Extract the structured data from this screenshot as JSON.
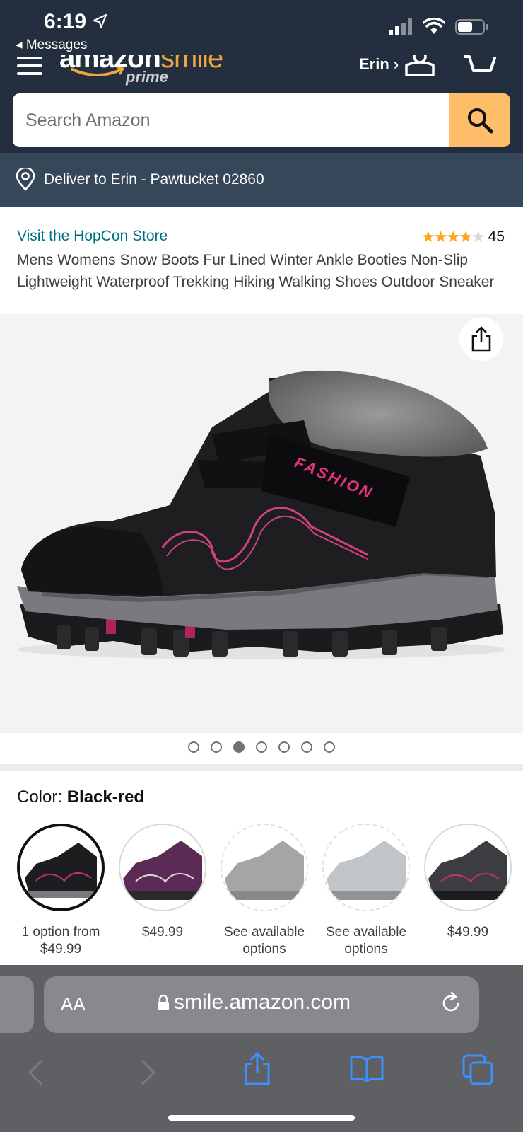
{
  "status_bar": {
    "time": "6:19",
    "back_label": "◂ Messages"
  },
  "header": {
    "logo_text": "amazon",
    "logo_smile": "smile",
    "logo_sub": "prime",
    "account_label": "Erin ›"
  },
  "search": {
    "placeholder": "Search Amazon"
  },
  "delivery": {
    "text": "Deliver to Erin - Pawtucket 02860"
  },
  "product": {
    "store_link": "Visit the HopCon Store",
    "rating_stars": 4,
    "rating_count": "45",
    "title": "Mens Womens Snow Boots Fur Lined Winter Ankle Booties Non-Slip Lightweight Waterproof Trekking Hiking Walking Shoes Outdoor Sneaker",
    "image_dots": 7,
    "active_dot": 2,
    "image_text": "FASHION"
  },
  "color": {
    "label": "Color:",
    "selected_value": "Black-red",
    "swatches": [
      {
        "name": "black-red",
        "caption": "1 option from $49.99",
        "selected": true
      },
      {
        "name": "purple",
        "caption": "$49.99",
        "selected": false
      },
      {
        "name": "grey",
        "caption": "See available options",
        "selected": false
      },
      {
        "name": "light-grey",
        "caption": "See available options",
        "selected": false
      },
      {
        "name": "dark-grey-red",
        "caption": "$49.99",
        "selected": false
      }
    ]
  },
  "browser": {
    "aa_label": "AA",
    "url": "smile.amazon.com"
  },
  "colors": {
    "header_bg": "#232f3e",
    "deliver_bg": "#37475a",
    "search_button": "#febd69",
    "link": "#007185",
    "star": "#ffa41c",
    "safari_bar": "#5e6064",
    "safari_icon": "#3e8fff"
  }
}
